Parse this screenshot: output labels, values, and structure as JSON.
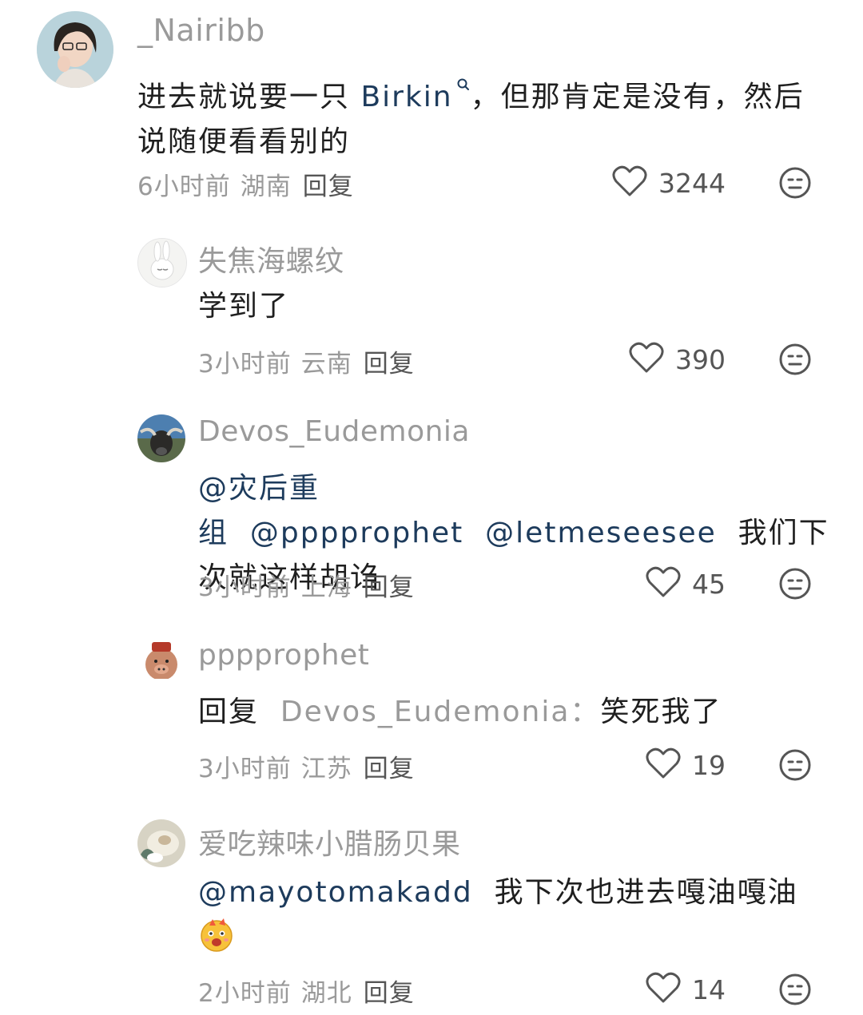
{
  "comments": [
    {
      "username": "_Nairibb",
      "text_before": "进去就说要一只 ",
      "keyword": "Birkin",
      "text_after": "，但那肯定是没有，然后说随便看看别的",
      "time": "6小时前",
      "location": "湖南",
      "reply_label": "回复",
      "likes": "3244"
    },
    {
      "username": "失焦海螺纹",
      "text": "学到了",
      "time": "3小时前",
      "location": "云南",
      "reply_label": "回复",
      "likes": "390"
    },
    {
      "username": "Devos_Eudemonia",
      "mention1": "@灾后重组",
      "mention2": "@pppprophet",
      "mention3": "@letmeseesee",
      "text": "我们下次就这样胡诌",
      "time": "3小时前",
      "location": "上海",
      "reply_label": "回复",
      "likes": "45"
    },
    {
      "username": "pppprophet",
      "reply_prefix": "回复",
      "reply_to": "Devos_Eudemonia：",
      "text": "笑死我了",
      "time": "3小时前",
      "location": "江苏",
      "reply_label": "回复",
      "likes": "19"
    },
    {
      "username": "爱吃辣味小腊肠贝果",
      "mention": "@mayotomakadd",
      "text": "我下次也进去嘎油嘎油",
      "time": "2小时前",
      "location": "湖北",
      "reply_label": "回复",
      "likes": "14"
    }
  ],
  "icons": {
    "like": "heart-outline-icon",
    "react": "emoji-reaction-icon",
    "keyword_search": "search-icon",
    "cheer_emoji": "cheering-face-emoji"
  },
  "colors": {
    "mention": "#1d3b5c",
    "meta": "#9a9a9a",
    "text": "#1f1f1f"
  }
}
